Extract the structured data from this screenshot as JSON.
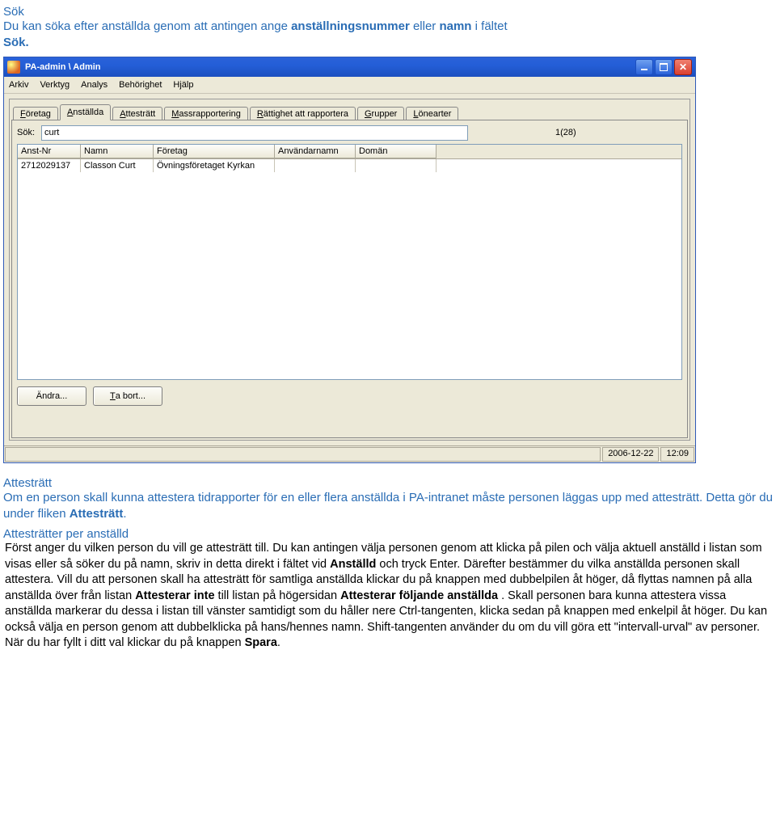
{
  "doc": {
    "heading1": "Sök",
    "intro_p1_a": "Du kan söka efter anställda genom att antingen ange ",
    "intro_p1_b": "anställningsnummer",
    "intro_p1_c": " eller ",
    "intro_p1_d": "namn",
    "intro_p1_e": " i fältet ",
    "intro_p1_f": "Sök.",
    "heading2": "Attesträtt",
    "att_p1_a": "Om en person skall kunna attestera tidrapporter för en eller flera anställda i PA-intranet måste personen läggas upp med attesträtt. Detta gör du under fliken ",
    "att_p1_b": "Attesträtt",
    "att_p1_c": ".",
    "heading3": "Attesträtter per anställd",
    "body_a": "Först anger du vilken person du vill ge attesträtt till. Du kan antingen välja personen genom att klicka på pilen och välja aktuell anställd i listan som visas eller så söker du på namn, skriv in detta direkt i fältet vid ",
    "body_b": "Anställd",
    "body_c": " och tryck Enter. Därefter bestämmer du vilka anställda personen skall attestera. Vill du att personen skall ha attesträtt för samtliga anställda klickar du på knappen med dubbelpilen åt höger, då flyttas namnen på alla anställda över från listan ",
    "body_d": "Attesterar inte",
    "body_e": " till listan på högersidan ",
    "body_f": "Attesterar följande anställda",
    "body_g": ". Skall personen bara kunna attestera vissa anställda markerar du dessa i listan till vänster samtidigt som du håller nere Ctrl-tangenten, klicka sedan på knappen med enkelpil åt höger. Du kan också välja en person genom att dubbelklicka på hans/hennes namn. Shift-tangenten använder du om du vill göra ett \"intervall-urval\" av personer. När du har fyllt i ditt val klickar du på knappen ",
    "body_h": "Spara",
    "body_i": "."
  },
  "window": {
    "title": "PA-admin \\ Admin",
    "menu": [
      "Arkiv",
      "Verktyg",
      "Analys",
      "Behörighet",
      "Hjälp"
    ],
    "tabs": [
      "Företag",
      "Anställda",
      "Attesträtt",
      "Massrapportering",
      "Rättighet att rapportera",
      "Grupper",
      "Lönearter"
    ],
    "active_tab_index": 1,
    "search_label": "Sök:",
    "search_value": "curt",
    "count": "1(28)",
    "columns": [
      "Anst-Nr",
      "Namn",
      "Företag",
      "Användarnamn",
      "Domän"
    ],
    "row": {
      "anstnr": "2712029137",
      "namn": "Classon Curt",
      "foretag": "Övningsföretaget Kyrkan",
      "anvnamn": "",
      "doman": ""
    },
    "btn_edit": "Ändra...",
    "btn_delete": "Ta bort...",
    "status_date": "2006-12-22",
    "status_time": "12:09"
  }
}
